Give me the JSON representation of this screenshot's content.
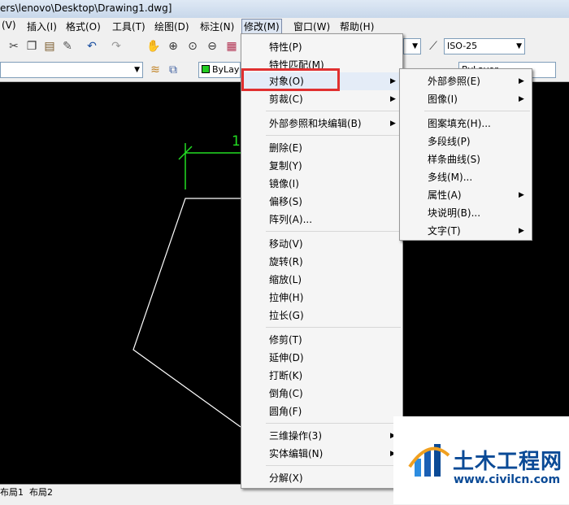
{
  "window": {
    "title": "ers\\lenovo\\Desktop\\Drawing1.dwg]"
  },
  "menubar": {
    "items": [
      "(V)",
      "插入(I)",
      "格式(O)",
      "工具(T)",
      "绘图(D)",
      "标注(N)",
      "修改(M)",
      "窗口(W)",
      "帮助(H)"
    ],
    "active": "修改(M)"
  },
  "toolbar": {
    "dimstyle_value": "ISO-25",
    "layer_value": "ByLay",
    "bylayer_value": "ByLayer",
    "colors": {
      "layer_swatch": "#22cc22",
      "accent_line": "#22dd22"
    }
  },
  "modify_menu": {
    "items": [
      {
        "label": "特性(P)",
        "submenu": false
      },
      {
        "label": "特性匹配(M)",
        "submenu": false
      },
      {
        "label": "对象(O)",
        "submenu": true,
        "highlighted": true
      },
      {
        "label": "剪裁(C)",
        "submenu": true
      },
      {
        "label": "外部参照和块编辑(B)",
        "submenu": true
      },
      {
        "label": "删除(E)",
        "submenu": false
      },
      {
        "label": "复制(Y)",
        "submenu": false
      },
      {
        "label": "镜像(I)",
        "submenu": false
      },
      {
        "label": "偏移(S)",
        "submenu": false
      },
      {
        "label": "阵列(A)...",
        "submenu": false
      },
      {
        "label": "移动(V)",
        "submenu": false
      },
      {
        "label": "旋转(R)",
        "submenu": false
      },
      {
        "label": "缩放(L)",
        "submenu": false
      },
      {
        "label": "拉伸(H)",
        "submenu": false
      },
      {
        "label": "拉长(G)",
        "submenu": false
      },
      {
        "label": "修剪(T)",
        "submenu": false
      },
      {
        "label": "延伸(D)",
        "submenu": false
      },
      {
        "label": "打断(K)",
        "submenu": false
      },
      {
        "label": "倒角(C)",
        "submenu": false
      },
      {
        "label": "圆角(F)",
        "submenu": false
      },
      {
        "label": "三维操作(3)",
        "submenu": true
      },
      {
        "label": "实体编辑(N)",
        "submenu": true
      },
      {
        "label": "分解(X)",
        "submenu": false
      }
    ]
  },
  "object_submenu": {
    "items": [
      {
        "label": "外部参照(E)",
        "submenu": true
      },
      {
        "label": "图像(I)",
        "submenu": true
      },
      {
        "label": "图案填充(H)...",
        "submenu": false
      },
      {
        "label": "多段线(P)",
        "submenu": false
      },
      {
        "label": "样条曲线(S)",
        "submenu": false
      },
      {
        "label": "多线(M)...",
        "submenu": false
      },
      {
        "label": "属性(A)",
        "submenu": true
      },
      {
        "label": "块说明(B)...",
        "submenu": false
      },
      {
        "label": "文字(T)",
        "submenu": true
      }
    ]
  },
  "drawing": {
    "dimension_text": "1"
  },
  "layout_tabs": [
    "布局1",
    "布局2"
  ],
  "watermark": {
    "name": "土木工程网",
    "url": "www.civilcn.com"
  }
}
